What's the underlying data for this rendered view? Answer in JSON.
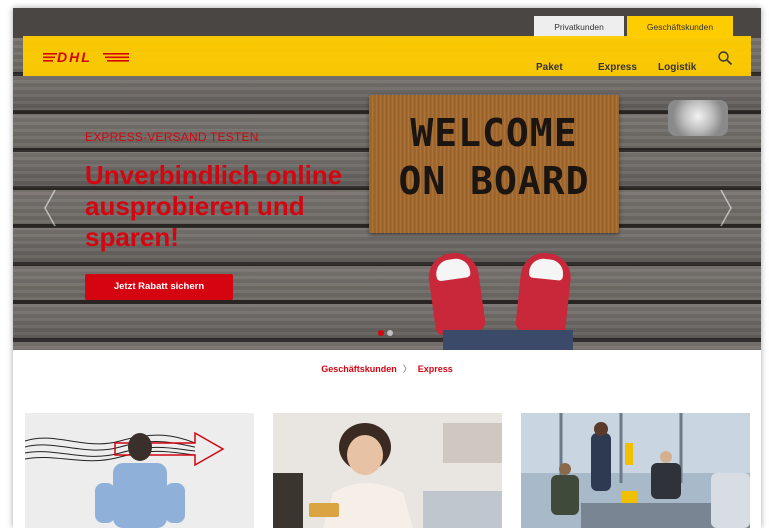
{
  "top_tabs": {
    "privat": "Privatkunden",
    "geschaeft": "Geschäftskunden"
  },
  "brand": {
    "logo": "DHL",
    "accent": "#ffcc00",
    "red": "#d40511"
  },
  "nav": {
    "paket": "Paket",
    "express": "Express",
    "logistik": "Logistik"
  },
  "hero": {
    "eyebrow": "EXPRESS-VERSAND TESTEN",
    "headline": "Unverbindlich online ausprobieren und sparen!",
    "cta": "Jetzt Rabatt sichern",
    "mat_line1": "WELCOME",
    "mat_line2": "ON BOARD"
  },
  "breadcrumb": {
    "level1": "Geschäftskunden",
    "separator": "〉",
    "level2": "Express"
  }
}
